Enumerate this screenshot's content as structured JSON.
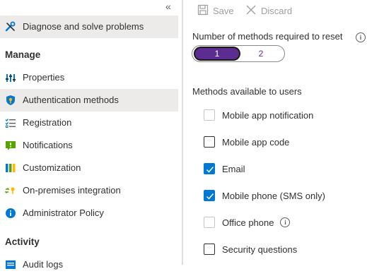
{
  "sidebar": {
    "collapse_glyph": "«",
    "items_top": [
      {
        "label": "Diagnose and solve problems",
        "icon": "wrench-cross-icon"
      }
    ],
    "group_manage": "Manage",
    "items_manage": [
      {
        "label": "Properties",
        "icon": "properties-bars-icon"
      },
      {
        "label": "Authentication methods",
        "icon": "shield-key-icon"
      },
      {
        "label": "Registration",
        "icon": "checklist-icon"
      },
      {
        "label": "Notifications",
        "icon": "notification-icon"
      },
      {
        "label": "Customization",
        "icon": "customization-bars-icon"
      },
      {
        "label": "On-premises integration",
        "icon": "sync-key-icon"
      },
      {
        "label": "Administrator Policy",
        "icon": "info-circle-icon"
      }
    ],
    "group_activity": "Activity",
    "items_activity": [
      {
        "label": "Audit logs",
        "icon": "log-icon"
      }
    ]
  },
  "toolbar": {
    "save_label": "Save",
    "discard_label": "Discard"
  },
  "main": {
    "methods_required_label": "Number of methods required to reset",
    "methods_required_options": [
      "1",
      "2"
    ],
    "methods_required_selected": "1",
    "methods_available_label": "Methods available to users",
    "methods": [
      {
        "label": "Mobile app notification",
        "checked": false,
        "disabled": true
      },
      {
        "label": "Mobile app code",
        "checked": false,
        "disabled": false
      },
      {
        "label": "Email",
        "checked": true,
        "disabled": false
      },
      {
        "label": "Mobile phone (SMS only)",
        "checked": true,
        "disabled": false
      },
      {
        "label": "Office phone",
        "checked": false,
        "disabled": true,
        "info": true
      },
      {
        "label": "Security questions",
        "checked": false,
        "disabled": false
      }
    ]
  },
  "colors": {
    "accent": "#0078d4",
    "toggle_selected": "#5c2d91",
    "selected_nav_bg": "#edebe9"
  }
}
